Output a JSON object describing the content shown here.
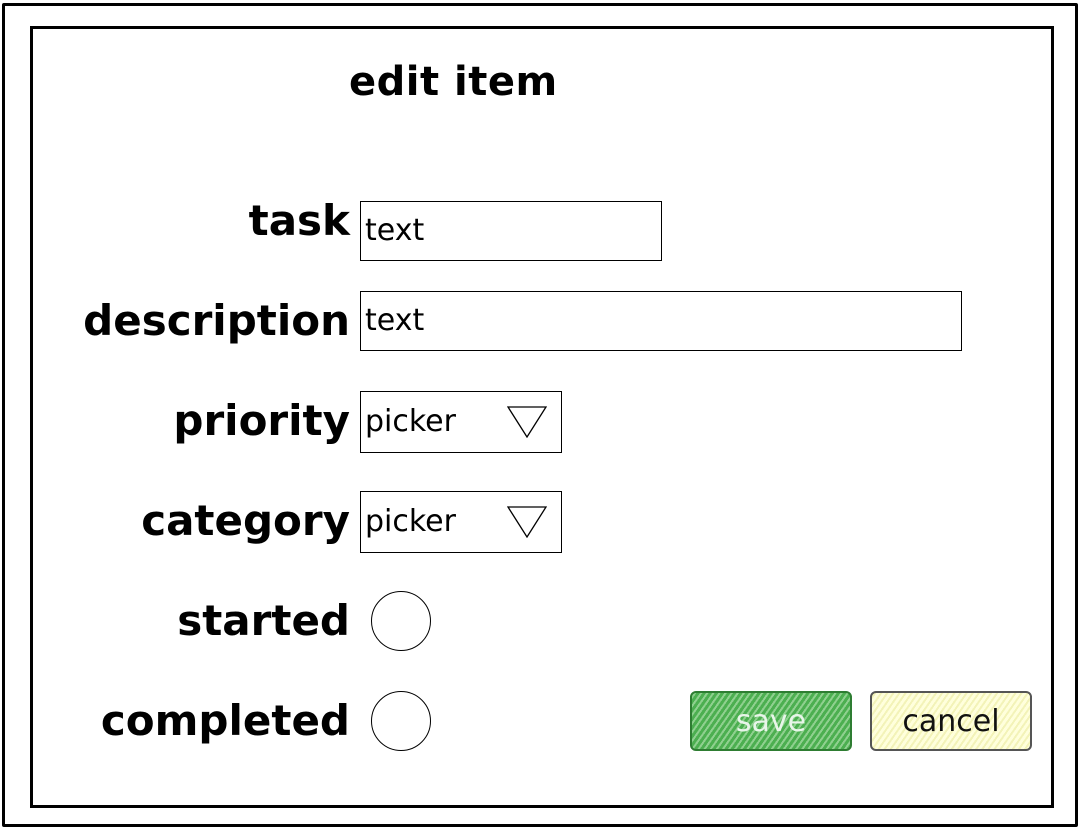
{
  "dialog": {
    "title": "edit item"
  },
  "fields": {
    "task": {
      "label": "task",
      "value": "text"
    },
    "description": {
      "label": "description",
      "value": "text"
    },
    "priority": {
      "label": "priority",
      "value": "picker"
    },
    "category": {
      "label": "category",
      "value": "picker"
    },
    "started": {
      "label": "started"
    },
    "completed": {
      "label": "completed"
    }
  },
  "buttons": {
    "save_label": "save",
    "cancel_label": "cancel"
  },
  "colors": {
    "save_fill": "#4caf50",
    "save_border": "#2e7d32",
    "cancel_fill": "#ffffdc"
  },
  "icons": {
    "picker_arrow": "triangle-down-outline",
    "checkbox": "circle-outline"
  }
}
